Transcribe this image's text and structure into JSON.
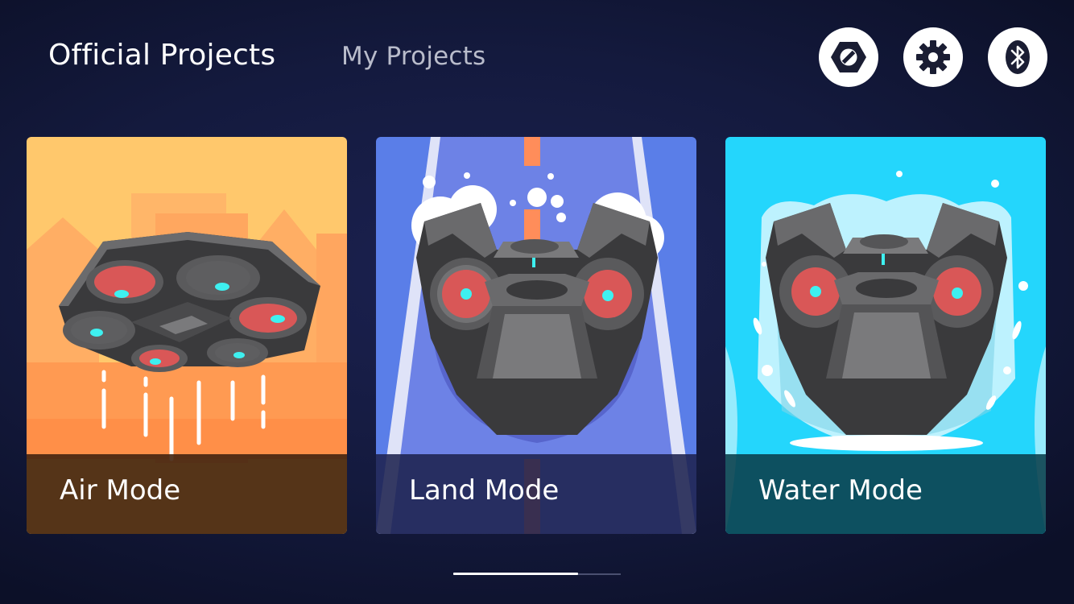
{
  "header": {
    "tabs": [
      {
        "label": "Official Projects",
        "active": true
      },
      {
        "label": "My Projects",
        "active": false
      }
    ],
    "actions": [
      {
        "icon": "hexagon-no-entry-icon"
      },
      {
        "icon": "gear-icon"
      },
      {
        "icon": "bluetooth-icon"
      }
    ]
  },
  "cards": [
    {
      "label": "Air Mode",
      "color": "#ffc86c"
    },
    {
      "label": "Land Mode",
      "color": "#5a7ee8"
    },
    {
      "label": "Water Mode",
      "color": "#24d6fc"
    }
  ],
  "pager": {
    "pages": 2,
    "current": 1
  },
  "colors": {
    "background": "#141a3e",
    "accent_red": "#d95757",
    "accent_cyan": "#3ef0f0"
  }
}
